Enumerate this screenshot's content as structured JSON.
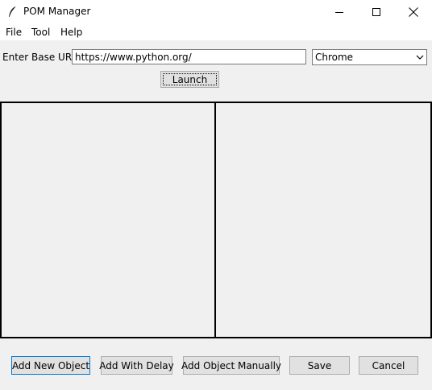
{
  "window": {
    "title": "POM Manager",
    "icon": "feather-icon",
    "controls": [
      "minimize-icon",
      "maximize-icon",
      "close-icon"
    ]
  },
  "menu": {
    "items": [
      {
        "label": "File"
      },
      {
        "label": "Tool"
      },
      {
        "label": "Help"
      }
    ]
  },
  "form": {
    "url_label": "Enter Base URL :",
    "url_value": "https://www.python.org/",
    "browser_selected": "Chrome",
    "launch_label": "Launch"
  },
  "actions": {
    "add_new_object": "Add New Object",
    "add_with_delay": "Add With Delay",
    "add_object_manually": "Add Object Manually",
    "save": "Save",
    "cancel": "Cancel"
  }
}
